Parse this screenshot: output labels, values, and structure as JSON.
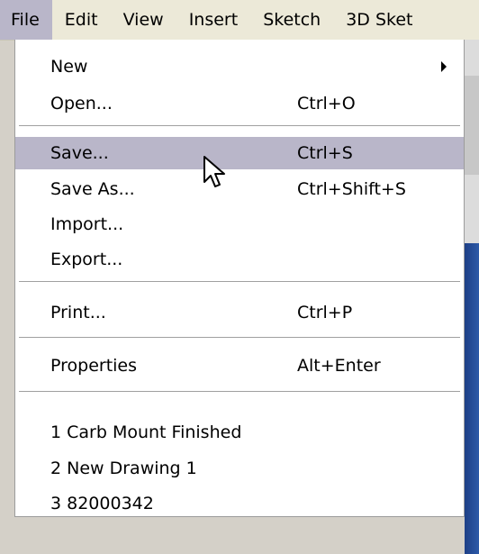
{
  "menubar": {
    "items": [
      "File",
      "Edit",
      "View",
      "Insert",
      "Sketch",
      "3D Sket"
    ]
  },
  "file_menu": {
    "new": {
      "label": "New",
      "has_submenu": true
    },
    "open": {
      "label": "Open...",
      "shortcut": "Ctrl+O"
    },
    "save": {
      "label": "Save...",
      "shortcut": "Ctrl+S",
      "highlighted": true
    },
    "save_as": {
      "label": "Save As...",
      "shortcut": "Ctrl+Shift+S"
    },
    "import": {
      "label": "Import..."
    },
    "export": {
      "label": "Export..."
    },
    "print": {
      "label": "Print...",
      "shortcut": "Ctrl+P"
    },
    "properties": {
      "label": "Properties",
      "shortcut": "Alt+Enter"
    },
    "recent": [
      "1 Carb Mount Finished",
      "2 New Drawing 1",
      "3 82000342"
    ]
  },
  "colors": {
    "highlight": "#b9b6c9",
    "menubar_bg": "#ece9d8",
    "menu_bg": "#ffffff"
  }
}
